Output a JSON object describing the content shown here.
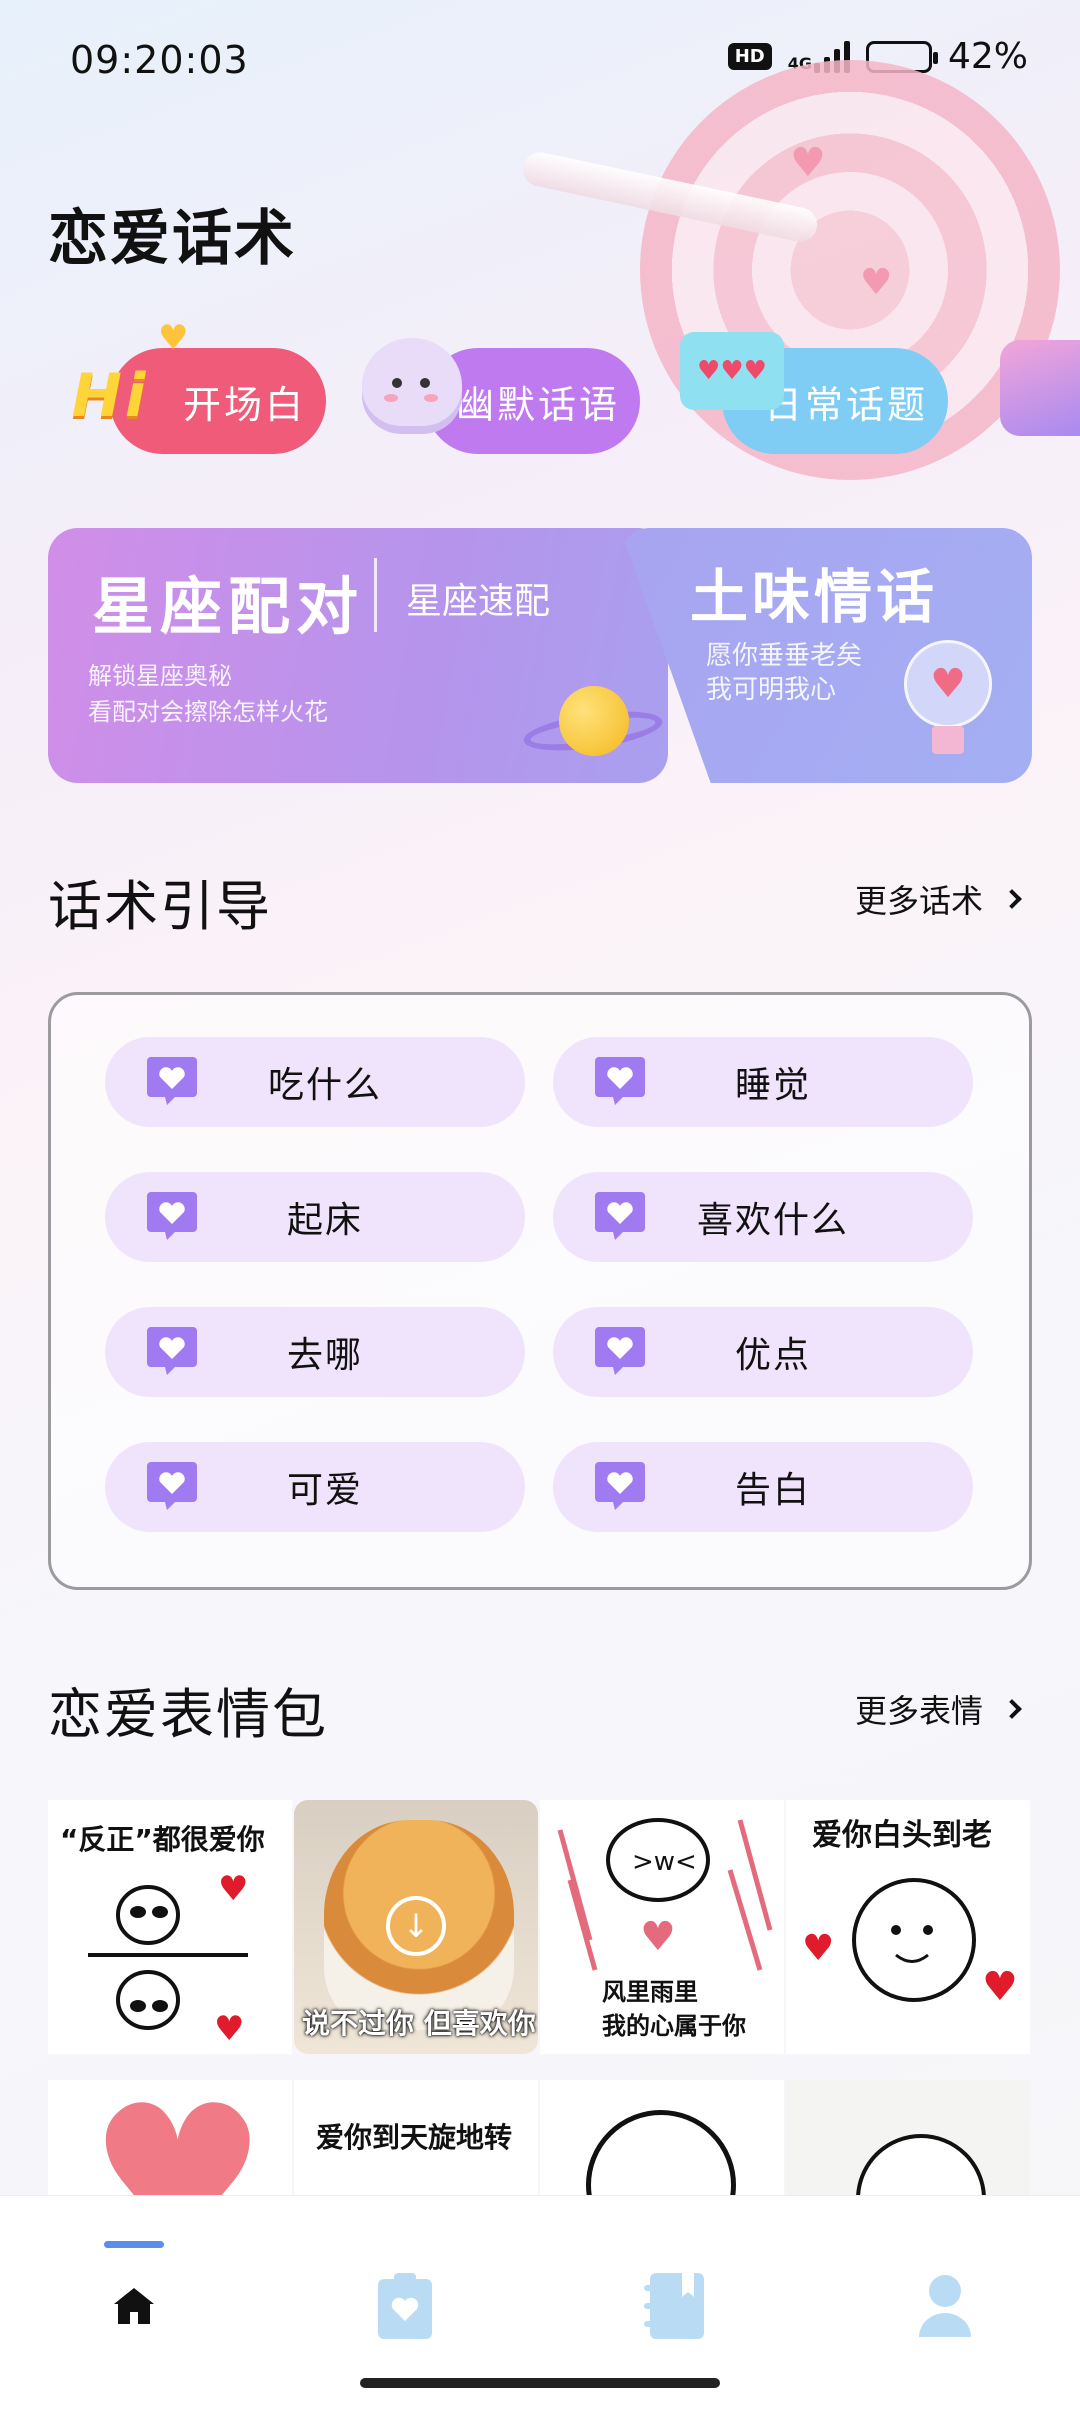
{
  "status_bar": {
    "time": "09:20:03",
    "hd": "HD",
    "network": "4G",
    "battery": "42%",
    "battery_level": 0.42
  },
  "page": {
    "title": "恋爱话术"
  },
  "categories": [
    {
      "badge": "Hi",
      "label": "开场白"
    },
    {
      "label": "幽默话语"
    },
    {
      "label": "日常话题"
    }
  ],
  "feature_cards": {
    "star": {
      "title": "星座配对",
      "tag": "星座速配",
      "sub1": "解锁星座奥秘",
      "sub2": "看配对会擦除怎样火花"
    },
    "love": {
      "title": "土味情话",
      "sub1": "愿你垂垂老矣",
      "sub2": "我可明我心"
    }
  },
  "guide": {
    "title": "话术引导",
    "more": "更多话术",
    "items": [
      "吃什么",
      "睡觉",
      "起床",
      "喜欢什么",
      "去哪",
      "优点",
      "可爱",
      "告白"
    ]
  },
  "stickers": {
    "title": "恋爱表情包",
    "more": "更多表情",
    "captions": [
      "“反正”都很爱你",
      "说不过你 但喜欢你",
      "风里雨里",
      "我的心属于你",
      "爱你白头到老",
      "爱你到天旋地转"
    ]
  },
  "colors": {
    "accent": "#5b8def",
    "chip_red": "#ef5b78",
    "chip_purple": "#c07af0",
    "chip_blue": "#7fcdf5",
    "pill_bg": "#efe4fb",
    "icon_purple": "#a07af0"
  }
}
